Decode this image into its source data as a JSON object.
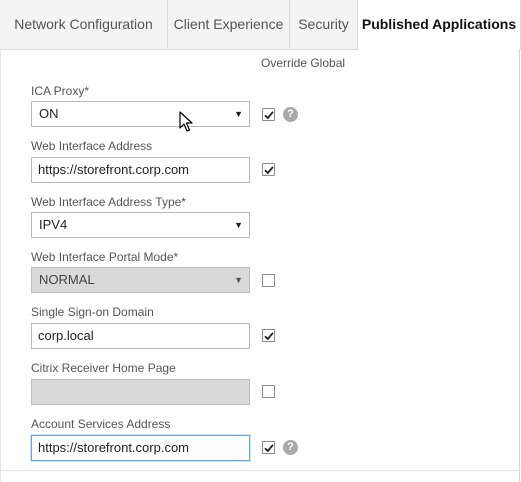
{
  "tabs": [
    {
      "label": "Network Configuration",
      "active": false
    },
    {
      "label": "Client Experience",
      "active": false
    },
    {
      "label": "Security",
      "active": false
    },
    {
      "label": "Published Applications",
      "active": true
    }
  ],
  "override_header": "Override Global",
  "fields": {
    "ica_proxy": {
      "label": "ICA Proxy*",
      "value": "ON",
      "type": "select",
      "override_checked": true,
      "has_help": true
    },
    "web_interface_address": {
      "label": "Web Interface Address",
      "value": "https://storefront.corp.com",
      "type": "text",
      "override_checked": true
    },
    "web_interface_address_type": {
      "label": "Web Interface Address Type*",
      "value": "IPV4",
      "type": "select"
    },
    "web_interface_portal_mode": {
      "label": "Web Interface Portal Mode*",
      "value": "NORMAL",
      "type": "select",
      "disabled": true,
      "override_checked": false
    },
    "single_sign_on_domain": {
      "label": "Single Sign-on Domain",
      "value": "corp.local",
      "type": "text",
      "override_checked": true
    },
    "citrix_receiver_home_page": {
      "label": "Citrix Receiver Home Page",
      "value": "",
      "type": "text",
      "disabled": true,
      "override_checked": false
    },
    "account_services_address": {
      "label": "Account Services Address",
      "value": "https://storefront.corp.com",
      "type": "text",
      "focused": true,
      "override_checked": true,
      "has_help": true
    }
  },
  "icons": {
    "help": "question-mark-icon",
    "dropdown": "caret-down-icon",
    "check": "checkmark-icon",
    "cursor": "mouse-pointer-icon"
  },
  "help_glyph": "?",
  "caret_glyph": "▼"
}
